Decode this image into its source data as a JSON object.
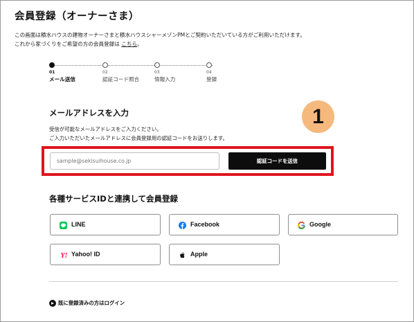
{
  "header": {
    "title": "会員登録（オーナーさま）"
  },
  "intro": {
    "line1": "この画面は積水ハウスの建物オーナーさまと積水ハウスシャーメゾンPMとご契約いただいている方がご利用いただけます。",
    "line2_prefix": "これから家づくりをご希望の方の会員登録は",
    "line2_link": "こちら",
    "line2_suffix": "。"
  },
  "steps": [
    {
      "num": "01",
      "label": "メール送信",
      "active": true
    },
    {
      "num": "02",
      "label": "認証コード照合",
      "active": false
    },
    {
      "num": "03",
      "label": "情報入力",
      "active": false
    },
    {
      "num": "04",
      "label": "登録",
      "active": false
    }
  ],
  "email_section": {
    "title": "メールアドレスを入力",
    "desc1": "受信が可能なメールアドレスをご入力ください。",
    "desc2": "ご入力いただいたメールアドレスに会員登録用の認証コードをお送りします。",
    "input_placeholder": "sample@sekisuihouse.co.jp",
    "send_button": "認証コードを送信",
    "callout_number": "1"
  },
  "sso_section": {
    "title": "各種サービスIDと連携して会員登録",
    "buttons": [
      {
        "label": "LINE",
        "icon": "line-icon"
      },
      {
        "label": "Facebook",
        "icon": "facebook-icon"
      },
      {
        "label": "Google",
        "icon": "google-icon"
      },
      {
        "label": "Yahoo! ID",
        "icon": "yahoo-icon"
      },
      {
        "label": "Apple",
        "icon": "apple-icon"
      }
    ]
  },
  "footer": {
    "login_link": "既に登録済みの方はログイン"
  },
  "colors": {
    "accent_red": "#e0141e",
    "badge_orange": "#f5b97e",
    "button_black": "#0d0d0d",
    "line_green": "#06c755",
    "facebook_blue": "#1877f2",
    "yahoo_red": "#ff0033"
  }
}
